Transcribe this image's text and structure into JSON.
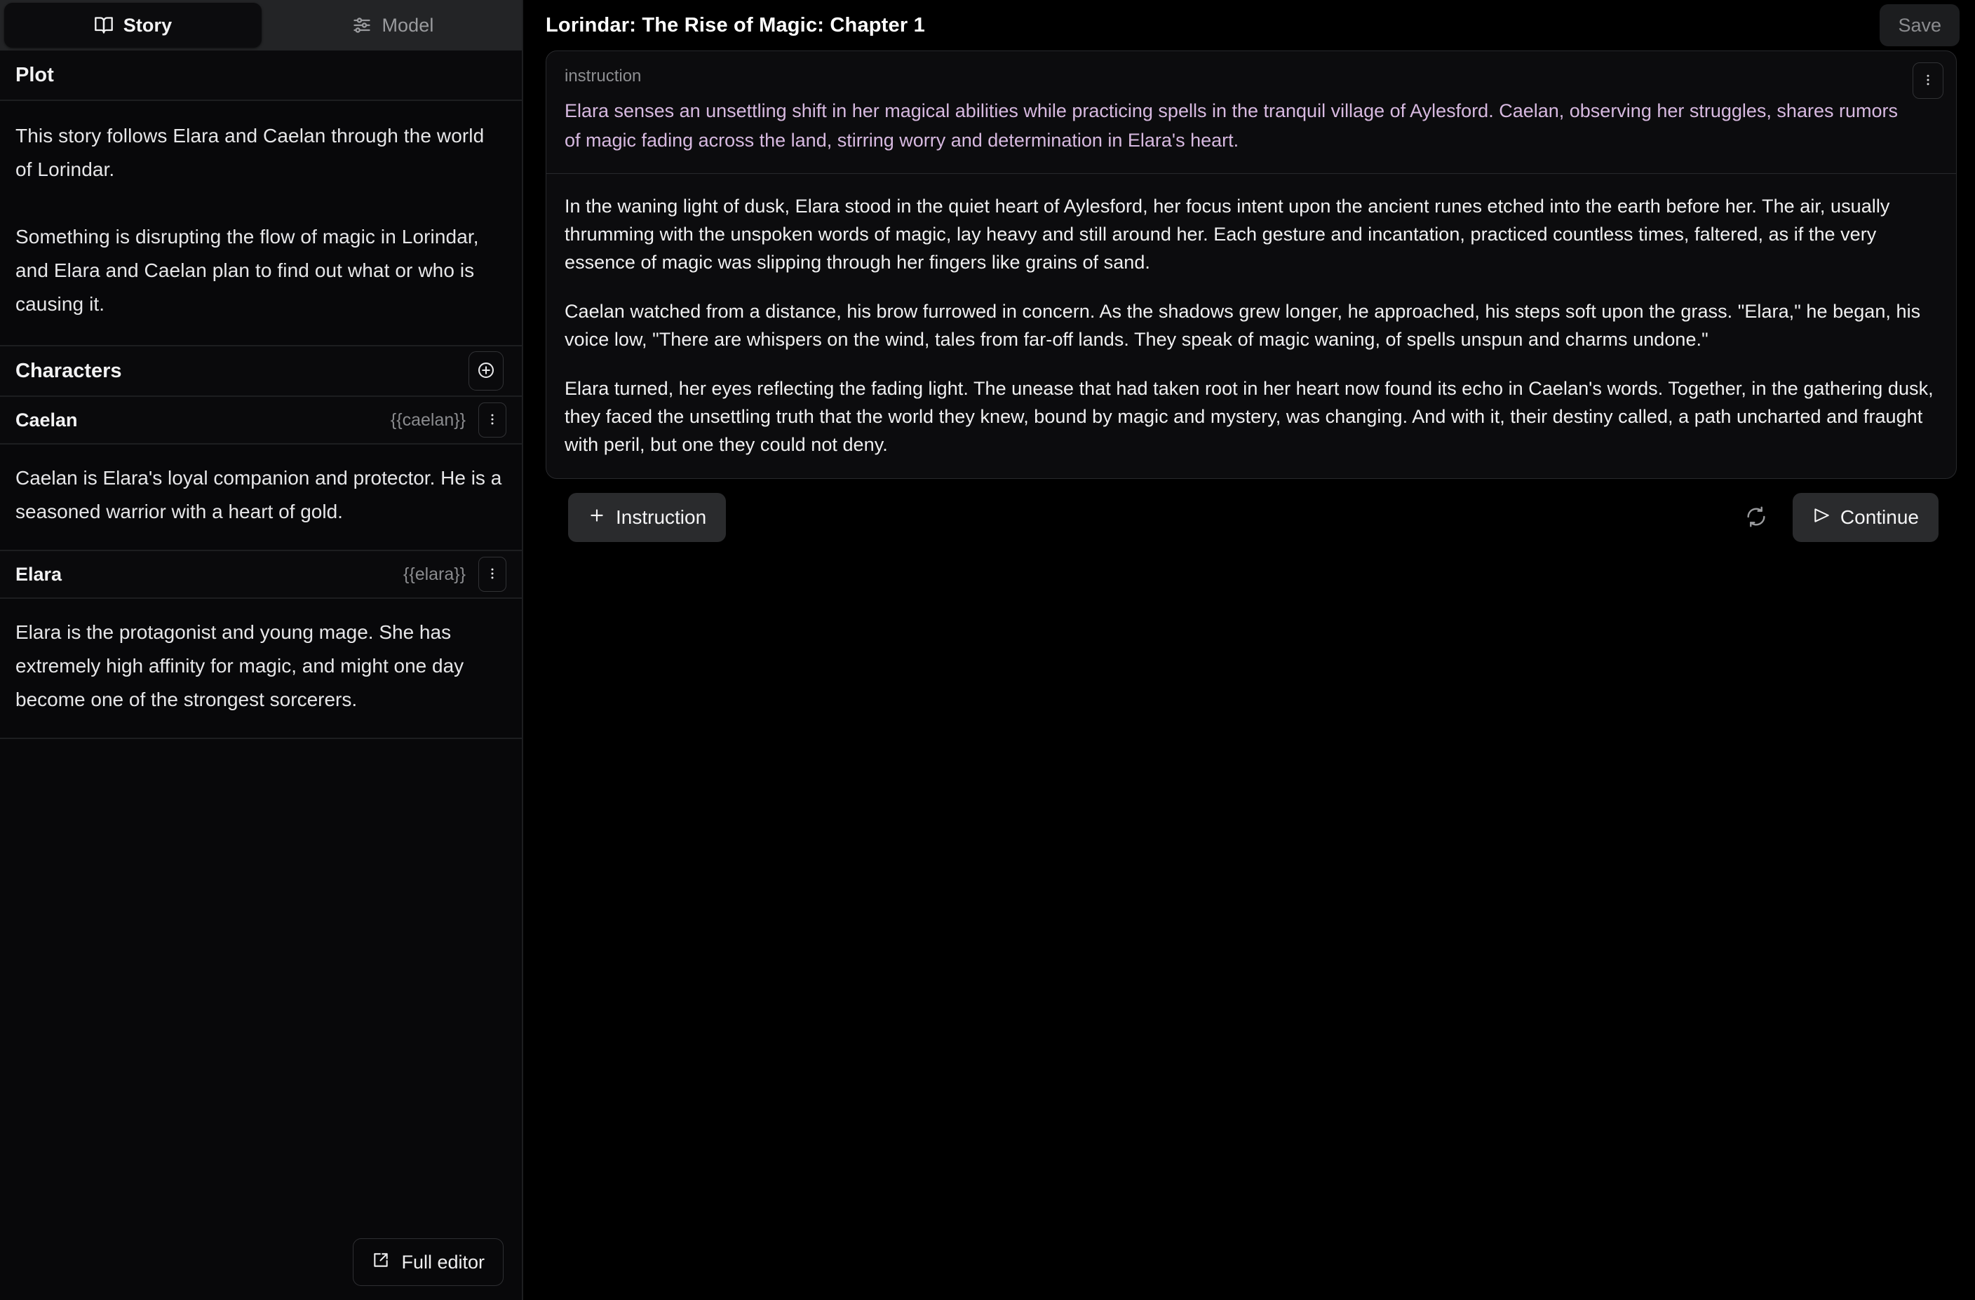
{
  "sidebar": {
    "tabs": [
      {
        "label": "Story",
        "icon": "book-open-icon",
        "active": true
      },
      {
        "label": "Model",
        "icon": "sliders-icon",
        "active": false
      }
    ],
    "plot": {
      "heading": "Plot",
      "add_icon": "plus-circle-icon",
      "paragraphs": [
        "This story follows Elara and Caelan through the world of Lorindar.",
        "Something is disrupting the flow of magic in Lorindar, and Elara and Caelan plan to find out what or who is causing it."
      ]
    },
    "characters": {
      "heading": "Characters",
      "add_icon": "plus-circle-icon",
      "menu_icon": "vertical-dots-icon",
      "items": [
        {
          "name": "Caelan",
          "token": "{{caelan}}",
          "description": "Caelan is Elara's loyal companion and protector. He is a seasoned warrior with a heart of gold."
        },
        {
          "name": "Elara",
          "token": "{{elara}}",
          "description": "Elara is the protagonist and young mage. She has extremely high affinity for magic, and might one day become one of the strongest sorcerers."
        }
      ]
    },
    "footer": {
      "full_editor_label": "Full editor",
      "full_editor_icon": "external-link-icon"
    }
  },
  "main": {
    "title": "Lorindar: The Rise of Magic: Chapter 1",
    "save_label": "Save",
    "instruction": {
      "label": "instruction",
      "text": "Elara senses an unsettling shift in her magical abilities while practicing spells in the tranquil village of Aylesford. Caelan, observing her struggles, shares rumors of magic fading across the land, stirring worry and determination in Elara's heart.",
      "menu_icon": "vertical-dots-icon",
      "color": "#d7b9e0"
    },
    "story_paragraphs": [
      "In the waning light of dusk, Elara stood in the quiet heart of Aylesford, her focus intent upon the ancient runes etched into the earth before her. The air, usually thrumming with the unspoken words of magic, lay heavy and still around her. Each gesture and incantation, practiced countless times, faltered, as if the very essence of magic was slipping through her fingers like grains of sand.",
      "Caelan watched from a distance, his brow furrowed in concern. As the shadows grew longer, he approached, his steps soft upon the grass. \"Elara,\" he began, his voice low, \"There are whispers on the wind, tales from far-off lands. They speak of magic waning, of spells unspun and charms undone.\"",
      "Elara turned, her eyes reflecting the fading light. The unease that had taken root in her heart now found its echo in Caelan's words. Together, in the gathering dusk, they faced the unsettling truth that the world they knew, bound by magic and mystery, was changing. And with it, their destiny called, a path uncharted and fraught with peril, but one they could not deny."
    ],
    "actions": {
      "add_instruction_label": "Instruction",
      "add_instruction_icon": "plus-icon",
      "regenerate_icon": "refresh-icon",
      "continue_label": "Continue",
      "continue_icon": "send-triangle-icon"
    }
  }
}
